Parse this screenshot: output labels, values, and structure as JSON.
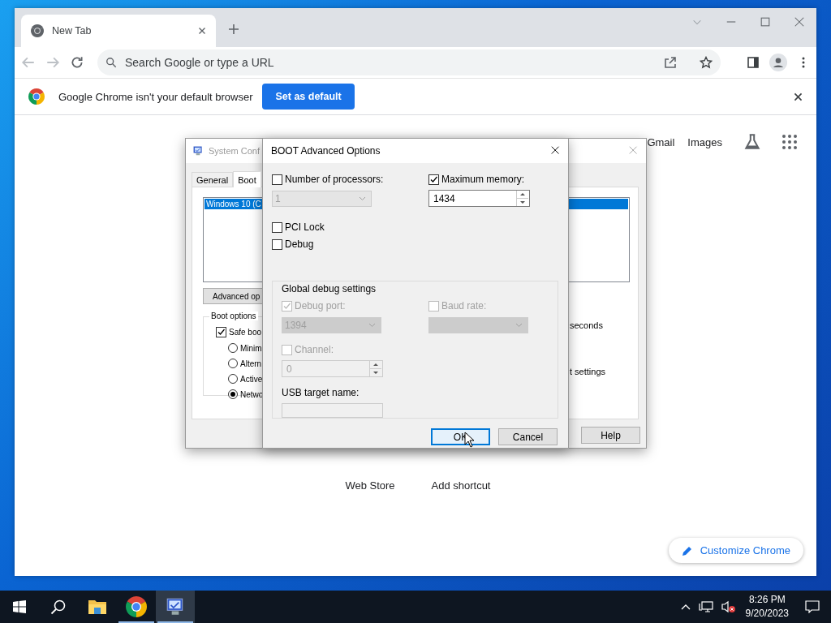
{
  "browser": {
    "tabs": [
      {
        "title": "New Tab",
        "selected": true
      }
    ],
    "address_bar": {
      "placeholder": "Search Google or type a URL"
    },
    "infobar": {
      "message": "Google Chrome isn't your default browser",
      "button": "Set as default"
    },
    "header_links": [
      "Gmail",
      "Images"
    ],
    "shortcuts": [
      {
        "label": "Web Store"
      },
      {
        "label": "Add shortcut"
      }
    ],
    "customize_button": "Customize Chrome"
  },
  "system_configuration": {
    "title": "System Conf",
    "tabs": [
      {
        "label": "General",
        "selected": false
      },
      {
        "label": "Boot",
        "selected": true
      }
    ],
    "boot_entries": [
      {
        "label": "Windows 10 (C",
        "selected": true
      }
    ],
    "advanced_button": "Advanced op",
    "boot_options": {
      "title": "Boot options",
      "safe_boot": {
        "label": "Safe boo",
        "checked": true
      },
      "modes": [
        {
          "label": "Minim",
          "selected": false
        },
        {
          "label": "Altern",
          "selected": false
        },
        {
          "label": "Active",
          "selected": false
        },
        {
          "label": "Netwo",
          "selected": true
        }
      ]
    },
    "timeout_unit": "seconds",
    "persistent_label": "t settings",
    "buttons": [
      "Help"
    ]
  },
  "dialog": {
    "title": "BOOT Advanced Options",
    "processors": {
      "label": "Number of processors:",
      "checked": false,
      "value": "1"
    },
    "max_memory": {
      "label": "Maximum memory:",
      "checked": true,
      "value": "1434"
    },
    "options": [
      {
        "label": "PCI Lock",
        "checked": false
      },
      {
        "label": "Debug",
        "checked": false
      }
    ],
    "debug_settings": {
      "title": "Global debug settings",
      "disabled": true,
      "debug_port": {
        "label": "Debug port:",
        "checked": true,
        "value": "1394"
      },
      "baud_rate": {
        "label": "Baud rate:",
        "checked": false
      },
      "channel": {
        "label": "Channel:",
        "checked": false,
        "value": "0"
      },
      "usb_target": {
        "label": "USB target name:"
      }
    },
    "buttons": [
      {
        "label": "OK",
        "focused": true
      },
      {
        "label": "Cancel",
        "focused": false
      }
    ]
  },
  "taskbar": {
    "apps": [
      {
        "kind": "explorer",
        "running": false,
        "active": false
      },
      {
        "kind": "chrome",
        "running": true,
        "active": false
      },
      {
        "kind": "msconfig",
        "running": true,
        "active": true
      }
    ],
    "time": "8:26 PM",
    "date": "9/20/2023"
  }
}
